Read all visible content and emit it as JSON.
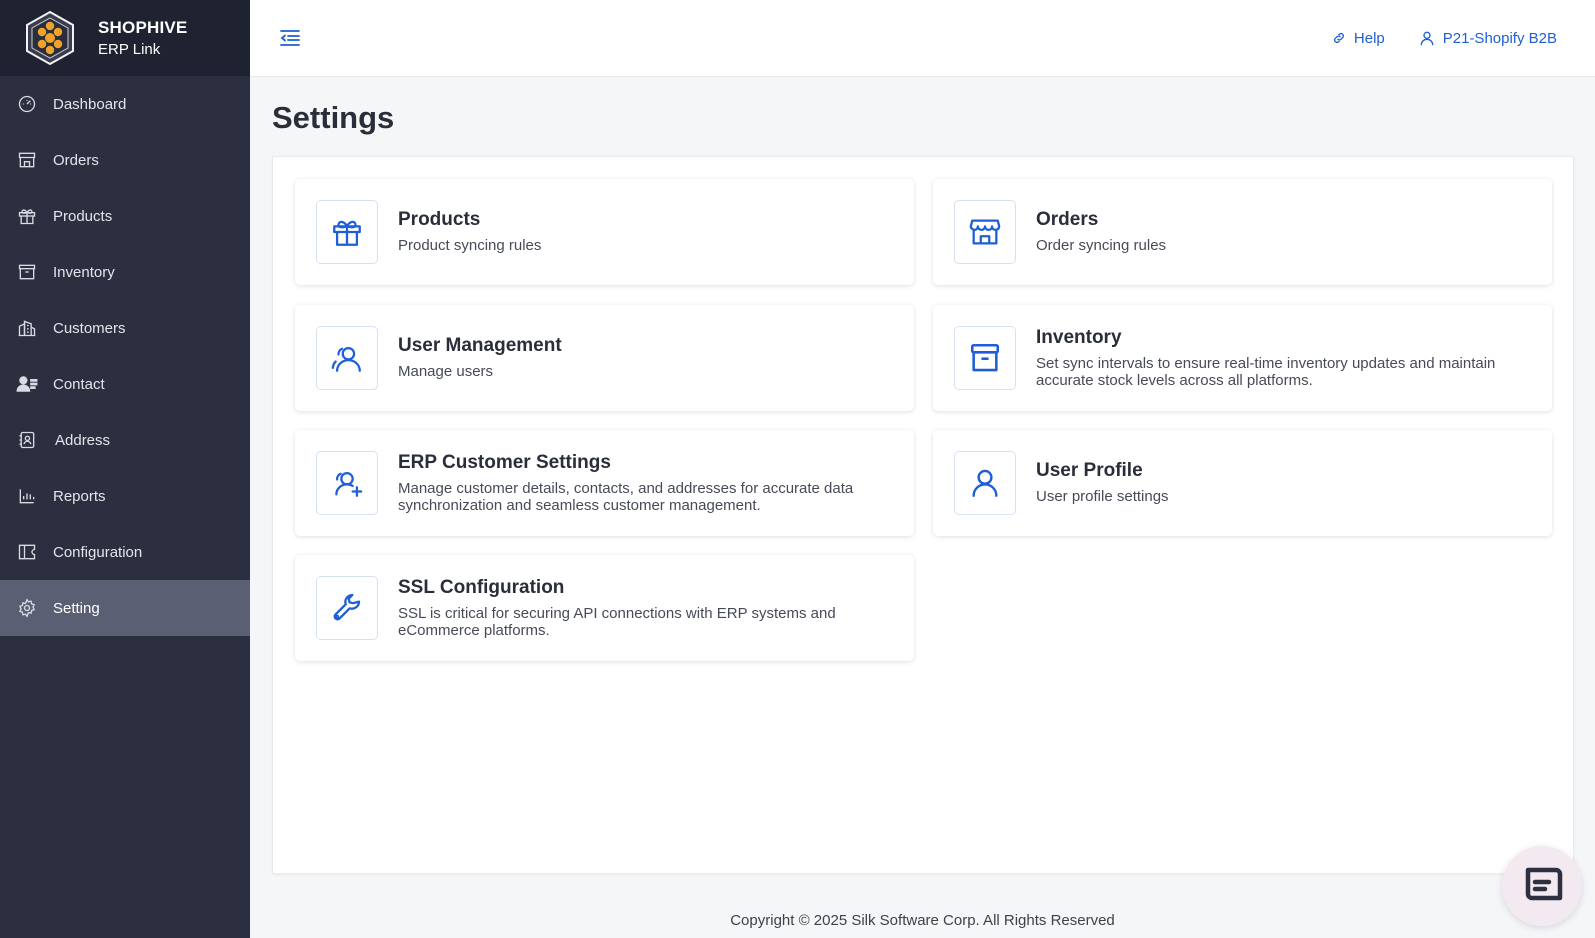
{
  "brand": {
    "title": "SHOPHIVE",
    "subtitle": "ERP Link"
  },
  "sidebar": {
    "items": [
      {
        "label": "Dashboard",
        "icon": "dashboard-icon"
      },
      {
        "label": "Orders",
        "icon": "store-icon"
      },
      {
        "label": "Products",
        "icon": "gift-icon"
      },
      {
        "label": "Inventory",
        "icon": "archive-icon"
      },
      {
        "label": "Customers",
        "icon": "buildings-icon"
      },
      {
        "label": "Contact",
        "icon": "contacts-icon"
      },
      {
        "label": "Address",
        "icon": "address-book-icon"
      },
      {
        "label": "Reports",
        "icon": "bar-chart-icon"
      },
      {
        "label": "Configuration",
        "icon": "ticket-icon"
      },
      {
        "label": "Setting",
        "icon": "gear-icon",
        "active": true
      }
    ]
  },
  "topbar": {
    "help_label": "Help",
    "user_label": "P21-Shopify B2B"
  },
  "page": {
    "title": "Settings"
  },
  "cards": [
    {
      "title": "Products",
      "description": "Product syncing rules",
      "icon": "gift-icon"
    },
    {
      "title": "Orders",
      "description": "Order syncing rules",
      "icon": "store-icon"
    },
    {
      "title": "User Management",
      "description": "Manage users",
      "icon": "users-icon"
    },
    {
      "title": "Inventory",
      "description": "Set sync intervals to ensure real-time inventory updates and maintain accurate stock levels across all platforms.",
      "icon": "archive-icon"
    },
    {
      "title": "ERP Customer Settings",
      "description": "Manage customer details, contacts, and addresses for accurate data synchronization and seamless customer management.",
      "icon": "user-plus-icon"
    },
    {
      "title": "User Profile",
      "description": "User profile settings",
      "icon": "user-icon"
    },
    {
      "title": "SSL Configuration",
      "description": "SSL is critical for securing API connections with ERP systems and eCommerce platforms.",
      "icon": "wrench-icon"
    }
  ],
  "footer": {
    "text": "Copyright © 2025 Silk Software Corp. All Rights Reserved"
  },
  "colors": {
    "sidebar_bg": "#2c2f3f",
    "brand_bg": "#1f2231",
    "active_bg": "#5b5f73",
    "accent": "#1f5fd6",
    "logo_orange": "#f0a32b"
  }
}
